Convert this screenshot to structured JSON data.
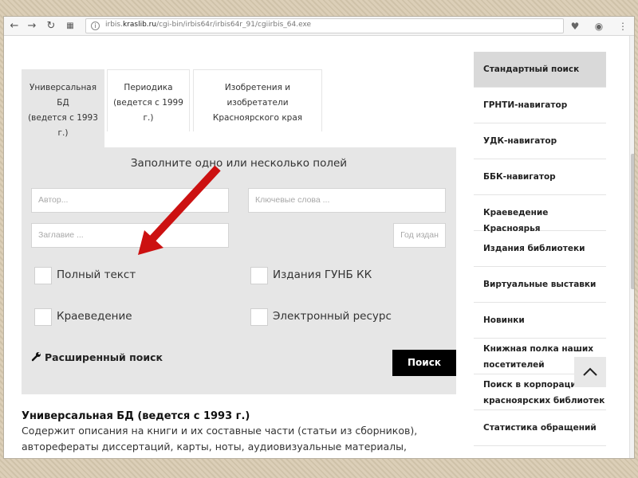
{
  "browser": {
    "url_prefix": "irbis.",
    "url_domain": "kraslib.ru",
    "url_path": "/cgi-bin/irbis64r/irbis64r_91/cgiirbis_64.exe"
  },
  "tabs": [
    {
      "label_lines": [
        "Универсальная",
        "БД",
        "(ведется с 1993",
        "г.)"
      ],
      "active": true
    },
    {
      "label_lines": [
        "Периодика",
        "(ведется с 1999",
        "г.)"
      ],
      "active": false
    },
    {
      "label_lines": [
        "Изобретения и",
        "изобретатели",
        "Красноярского края"
      ],
      "active": false
    }
  ],
  "search": {
    "title": "Заполните одно или несколько полей",
    "author_placeholder": "Автор...",
    "keywords_placeholder": "Ключевые слова ...",
    "title_placeholder": "Заглавие ...",
    "year_placeholder": "Год издан",
    "checkboxes": [
      "Полный текст",
      "Издания ГУНБ КК",
      "Краеведение",
      "Электронный ресурс"
    ],
    "advanced_label": "Расширенный поиск",
    "search_button": "Поиск"
  },
  "description": {
    "title": "Универсальная БД (ведется с 1993 г.)",
    "text_lines": [
      "Содержит описания на книги и их составные части (статьи из сборников),",
      "автореферaты диссертаций, карты, ноты, аудиовизуальные материалы,"
    ]
  },
  "sidebar": {
    "items": [
      {
        "label_lines": [
          "Стандартный поиск"
        ],
        "active": true
      },
      {
        "label_lines": [
          "ГРНТИ-навигатор"
        ],
        "active": false
      },
      {
        "label_lines": [
          "УДК-навигатор"
        ],
        "active": false
      },
      {
        "label_lines": [
          "ББК-навигатор"
        ],
        "active": false
      },
      {
        "label_lines": [
          "Краеведение Красноярья"
        ],
        "active": false
      },
      {
        "label_lines": [
          "Издания библиотеки"
        ],
        "active": false
      },
      {
        "label_lines": [
          "Виртуальные выставки"
        ],
        "active": false
      },
      {
        "label_lines": [
          "Новинки"
        ],
        "active": false
      },
      {
        "label_lines": [
          "Книжная полка наших",
          "посетителей"
        ],
        "active": false
      },
      {
        "label_lines": [
          "Поиск в корпорации",
          "красноярских библиотек"
        ],
        "active": false
      },
      {
        "label_lines": [
          "Статистика обращений"
        ],
        "active": false
      }
    ]
  },
  "colors": {
    "panel_bg": "#e6e6e6",
    "search_button_bg": "#000000",
    "arrow": "#cc1111"
  }
}
